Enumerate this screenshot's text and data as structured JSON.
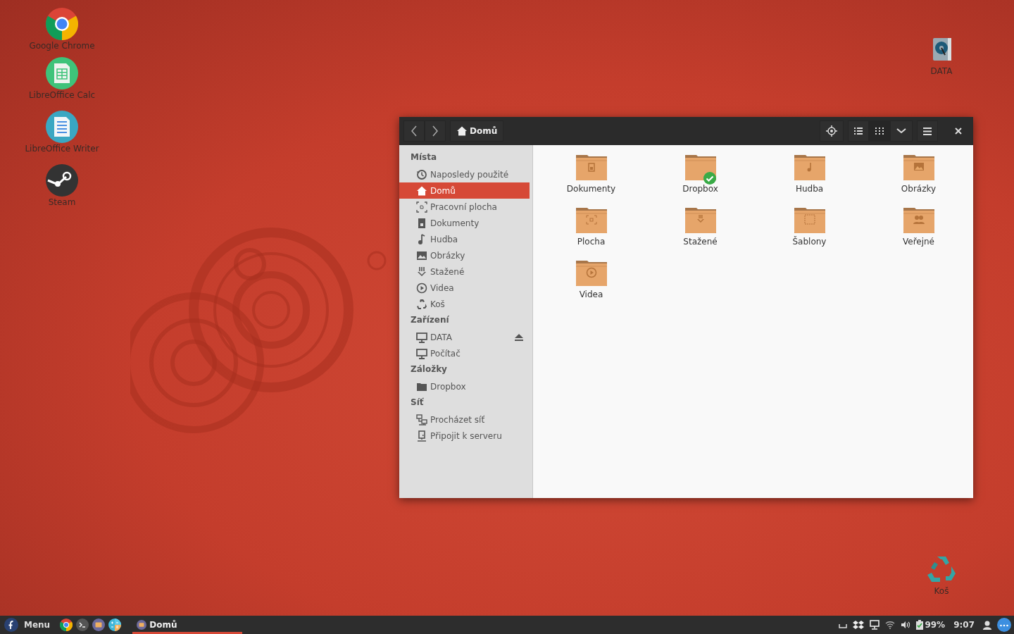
{
  "desktop_icons": [
    {
      "label": "Google Chrome",
      "kind": "chrome"
    },
    {
      "label": "LibreOffice Calc",
      "kind": "calc"
    },
    {
      "label": "LibreOffice Writer",
      "kind": "writer"
    },
    {
      "label": "Steam",
      "kind": "steam"
    }
  ],
  "desktop_right_icons": [
    {
      "label": "DATA",
      "kind": "disk"
    },
    {
      "label": "Koš",
      "kind": "trash"
    }
  ],
  "window": {
    "location": "Domů",
    "sidebar": [
      {
        "title": "Místa",
        "items": [
          {
            "label": "Naposledy použité",
            "kind": "recent",
            "selected": false
          },
          {
            "label": "Domů",
            "kind": "home",
            "selected": true
          },
          {
            "label": "Pracovní plocha",
            "kind": "desktop",
            "selected": false
          },
          {
            "label": "Dokumenty",
            "kind": "document",
            "selected": false
          },
          {
            "label": "Hudba",
            "kind": "music",
            "selected": false
          },
          {
            "label": "Obrázky",
            "kind": "picture",
            "selected": false
          },
          {
            "label": "Stažené",
            "kind": "download",
            "selected": false
          },
          {
            "label": "Videa",
            "kind": "video",
            "selected": false
          },
          {
            "label": "Koš",
            "kind": "trash",
            "selected": false
          }
        ]
      },
      {
        "title": "Zařízení",
        "items": [
          {
            "label": "DATA",
            "kind": "monitor",
            "selected": false,
            "ejectable": true
          },
          {
            "label": "Počítač",
            "kind": "monitor",
            "selected": false,
            "ejectable": false
          }
        ]
      },
      {
        "title": "Záložky",
        "items": [
          {
            "label": "Dropbox",
            "kind": "folder",
            "selected": false
          }
        ]
      },
      {
        "title": "Síť",
        "items": [
          {
            "label": "Procházet síť",
            "kind": "network",
            "selected": false
          },
          {
            "label": "Připojit k serveru",
            "kind": "server",
            "selected": false
          }
        ]
      }
    ],
    "files": [
      {
        "label": "Dokumenty",
        "kind": "document",
        "synced": false
      },
      {
        "label": "Dropbox",
        "kind": "plain",
        "synced": true
      },
      {
        "label": "Hudba",
        "kind": "music",
        "synced": false
      },
      {
        "label": "Obrázky",
        "kind": "picture",
        "synced": false
      },
      {
        "label": "Plocha",
        "kind": "desktop",
        "synced": false
      },
      {
        "label": "Stažené",
        "kind": "download",
        "synced": false
      },
      {
        "label": "Šablony",
        "kind": "template",
        "synced": false
      },
      {
        "label": "Veřejné",
        "kind": "people",
        "synced": false
      },
      {
        "label": "Videa",
        "kind": "video",
        "synced": false
      }
    ]
  },
  "taskbar": {
    "menu_label": "Menu",
    "launchers": [
      {
        "kind": "chrome"
      },
      {
        "kind": "terminal"
      },
      {
        "kind": "files"
      },
      {
        "kind": "calculator"
      }
    ],
    "tasks": [
      {
        "label": "Domů",
        "selected": true
      }
    ],
    "battery": "99%",
    "clock": "9:07"
  }
}
